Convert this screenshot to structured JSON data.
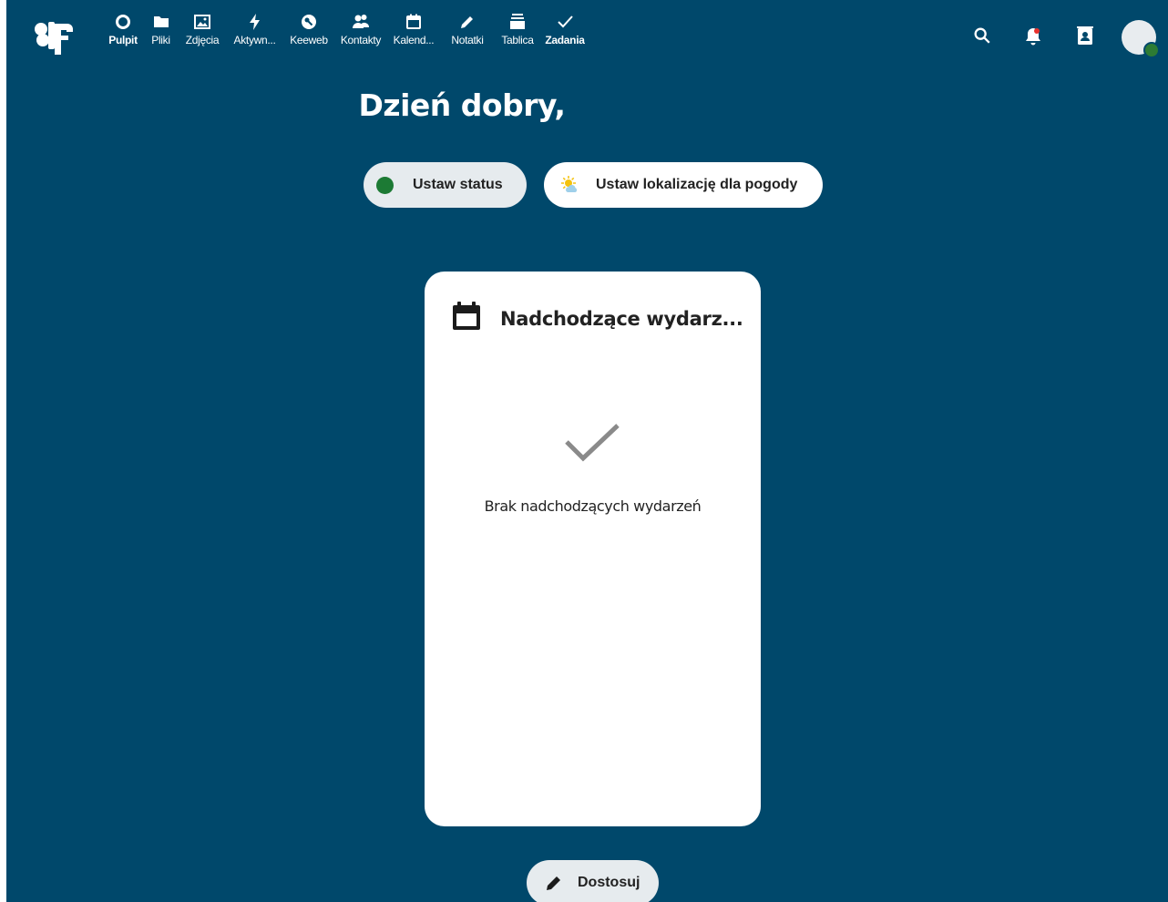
{
  "nav": {
    "items": [
      {
        "label": "Pulpit",
        "icon": "dashboard-icon",
        "active": true
      },
      {
        "label": "Pliki",
        "icon": "folder-icon"
      },
      {
        "label": "Zdjęcia",
        "icon": "image-icon"
      },
      {
        "label": "Aktywn...",
        "icon": "lightning-icon"
      },
      {
        "label": "Keeweb",
        "icon": "key-icon"
      },
      {
        "label": "Kontakty",
        "icon": "contacts-icon"
      },
      {
        "label": "Kalend...",
        "icon": "calendar-icon"
      },
      {
        "label": "Notatki",
        "icon": "pencil-icon"
      },
      {
        "label": "Tablica",
        "icon": "deck-icon"
      },
      {
        "label": "Zadania",
        "icon": "check-icon",
        "active": true
      }
    ]
  },
  "greeting": "Dzień dobry,",
  "status_button": "Ustaw status",
  "weather_button": "Ustaw lokalizację dla pogody",
  "widget": {
    "title": "Nadchodzące wydarz...",
    "empty_message": "Brak nadchodzących wydarzeń"
  },
  "customize_button": "Dostosuj",
  "colors": {
    "background": "#00486b",
    "status_online": "#1c7a34",
    "pill_light": "#e6ebee"
  }
}
